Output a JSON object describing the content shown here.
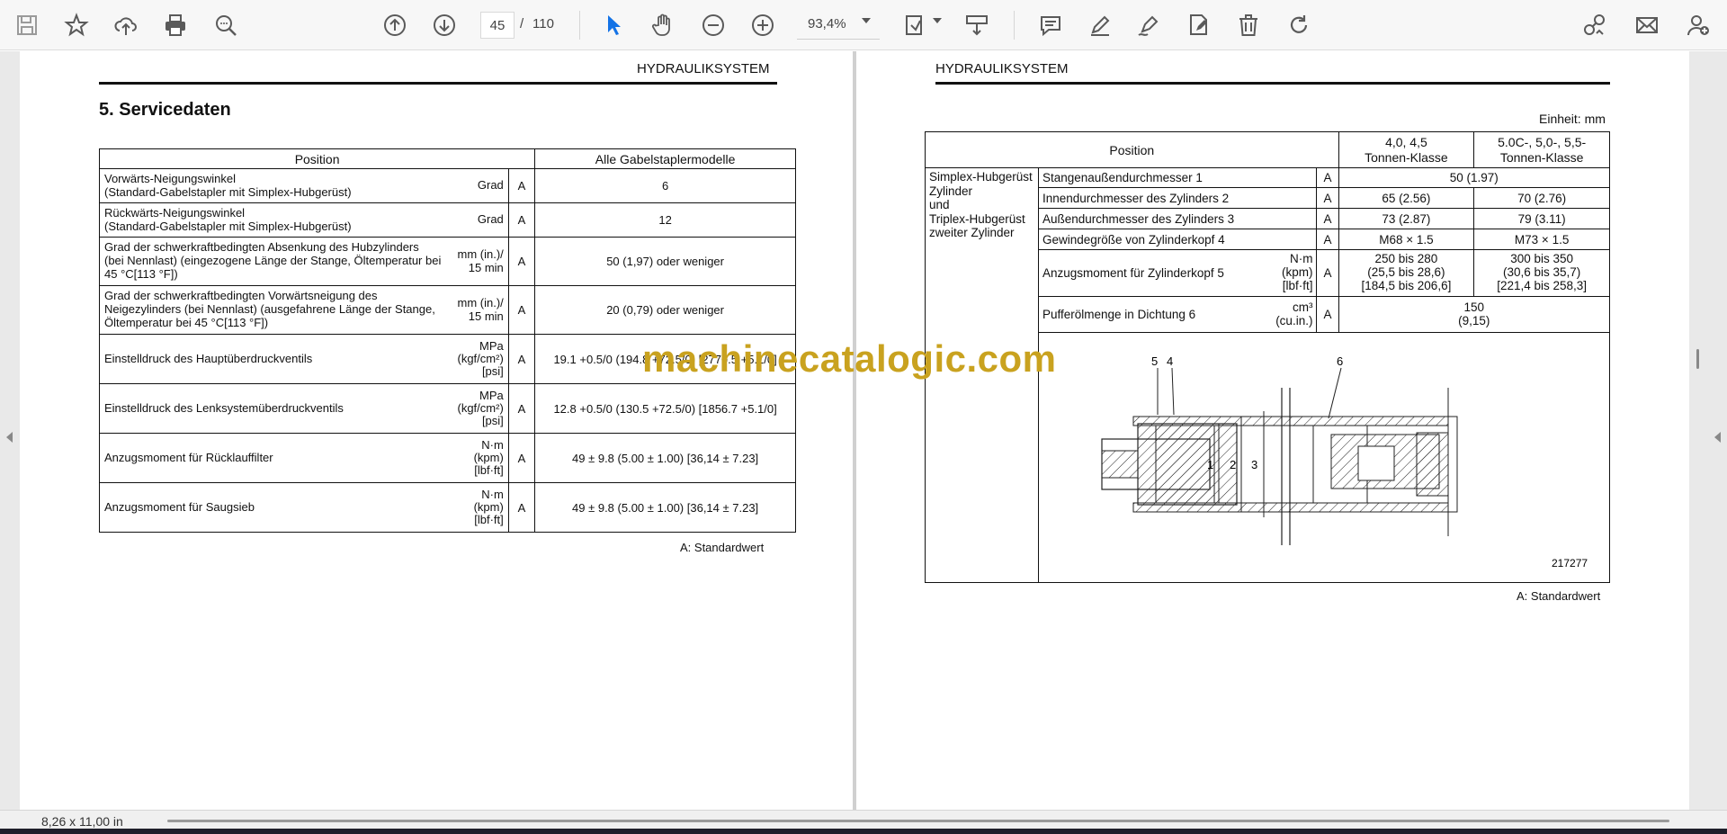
{
  "toolbar": {
    "page_current": "45",
    "page_separator": "/",
    "page_total": "110",
    "zoom": "93,4%",
    "icon_color": "#5a5a5a",
    "accent_color": "#1473e6"
  },
  "left_page": {
    "header": "HYDRAULIKSYSTEM",
    "section_title": "5.  Servicedaten",
    "table": {
      "col_position": "Position",
      "col_models": "Alle Gabelstaplermodelle",
      "rows": [
        {
          "desc": "Vorwärts-Neigungswinkel\n(Standard-Gabelstapler mit Simplex-Hubgerüst)",
          "unit": "Grad",
          "a": "A",
          "value": "6"
        },
        {
          "desc": "Rückwärts-Neigungswinkel\n(Standard-Gabelstapler mit Simplex-Hubgerüst)",
          "unit": "Grad",
          "a": "A",
          "value": "12"
        },
        {
          "desc": "Grad der schwerkraftbedingten Absenkung des Hubzylinders (bei Nennlast) (eingezogene Länge der Stange, Öltemperatur bei 45 °C[113 °F])",
          "unit": "mm (in.)/\n15 min",
          "a": "A",
          "value": "50 (1,97) oder weniger"
        },
        {
          "desc": "Grad der schwerkraftbedingten Vorwärtsneigung des Neigezylinders (bei Nennlast) (ausgefahrene Länge der Stange, Öltemperatur bei 45 °C[113 °F])",
          "unit": "mm (in.)/\n15 min",
          "a": "A",
          "value": "20 (0,79) oder weniger"
        },
        {
          "desc": "Einstelldruck des Hauptüberdruckventils",
          "unit": "MPa\n(kgf/cm²)\n[psi]",
          "a": "A",
          "value": "19.1 +0.5/0 (194.8 +72.5/0) [2770.5 +5.1/0]"
        },
        {
          "desc": "Einstelldruck des Lenksystemüberdruckventils",
          "unit": "MPa\n(kgf/cm²)\n[psi]",
          "a": "A",
          "value": "12.8 +0.5/0 (130.5 +72.5/0) [1856.7 +5.1/0]"
        },
        {
          "desc": "Anzugsmoment für Rücklauffilter",
          "unit": "N·m\n(kpm)\n[lbf·ft]",
          "a": "A",
          "value": "49 ± 9.8 (5.00 ± 1.00) [36,14 ± 7.23]"
        },
        {
          "desc": "Anzugsmoment für Saugsieb",
          "unit": "N·m\n(kpm)\n[lbf·ft]",
          "a": "A",
          "value": "49 ± 9.8 (5.00 ± 1.00) [36,14 ± 7.23]"
        }
      ]
    },
    "footnote": "A: Standardwert"
  },
  "right_page": {
    "header": "HYDRAULIKSYSTEM",
    "einheit": "Einheit: mm",
    "table": {
      "col_position": "Position",
      "col_class1": "4,0, 4,5\nTonnen-Klasse",
      "col_class2": "5.0C-, 5,0-, 5,5-\nTonnen-Klasse",
      "group": "Simplex-Hubgerüst\nZylinder\nund\nTriplex-Hubgerüst\nzweiter Zylinder",
      "r1_desc": "Stangenaußendurchmesser 1",
      "r1_a": "A",
      "r1_val": "50 (1.97)",
      "r2_desc": "Innendurchmesser des Zylinders 2",
      "r2_a": "A",
      "r2_v1": "65 (2.56)",
      "r2_v2": "70 (2.76)",
      "r3_desc": "Außendurchmesser des Zylinders 3",
      "r3_a": "A",
      "r3_v1": "73 (2.87)",
      "r3_v2": "79 (3.11)",
      "r4_desc": "Gewindegröße von Zylinderkopf 4",
      "r4_a": "A",
      "r4_v1": "M68 × 1.5",
      "r4_v2": "M73 × 1.5",
      "r5_desc": "Anzugsmoment für Zylinderkopf 5",
      "r5_unit": "N·m\n(kpm)\n[lbf·ft]",
      "r5_a": "A",
      "r5_v1": "250 bis 280\n(25,5 bis 28,6)\n[184,5 bis 206,6]",
      "r5_v2": "300 bis 350\n(30,6 bis 35,7)\n[221,4 bis 258,3]",
      "r6_desc": "Pufferölmenge in Dichtung 6",
      "r6_unit": "cm³\n(cu.in.)",
      "r6_a": "A",
      "r6_val": "150\n(9,15)"
    },
    "diagram": {
      "labels": [
        "5",
        "4",
        "6",
        "1",
        "2",
        "3"
      ],
      "figure_id": "217277"
    },
    "footnote": "A: Standardwert"
  },
  "watermark": "machinecatalogic.com",
  "status": {
    "page_size": "8,26 x 11,00 in"
  }
}
